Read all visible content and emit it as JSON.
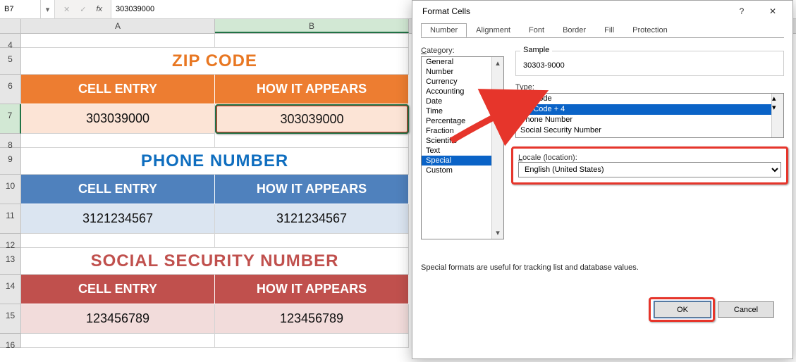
{
  "formula_bar": {
    "name_box": "B7",
    "cancel_icon": "✕",
    "accept_icon": "✓",
    "fx_label": "fx",
    "value": "303039000"
  },
  "columns": [
    "A",
    "B"
  ],
  "rows": [
    "4",
    "5",
    "6",
    "7",
    "8",
    "9",
    "10",
    "11",
    "12",
    "13",
    "14",
    "15",
    "16"
  ],
  "sections": {
    "zip": {
      "title": "ZIP CODE",
      "col1_header": "CELL ENTRY",
      "col2_header": "HOW IT APPEARS",
      "col1_value": "303039000",
      "col2_value": "303039000"
    },
    "phone": {
      "title": "PHONE NUMBER",
      "col1_header": "CELL ENTRY",
      "col2_header": "HOW IT APPEARS",
      "col1_value": "3121234567",
      "col2_value": "3121234567"
    },
    "ssn": {
      "title": "SOCIAL SECURITY NUMBER",
      "col1_header": "CELL ENTRY",
      "col2_header": "HOW IT APPEARS",
      "col1_value": "123456789",
      "col2_value": "123456789"
    }
  },
  "dialog": {
    "title": "Format Cells",
    "help_icon": "?",
    "close_icon": "✕",
    "tabs": [
      "Number",
      "Alignment",
      "Font",
      "Border",
      "Fill",
      "Protection"
    ],
    "active_tab": "Number",
    "category_label": "Category:",
    "categories": [
      "General",
      "Number",
      "Currency",
      "Accounting",
      "Date",
      "Time",
      "Percentage",
      "Fraction",
      "Scientific",
      "Text",
      "Special",
      "Custom"
    ],
    "selected_category": "Special",
    "sample_label": "Sample",
    "sample_value": "30303-9000",
    "type_label": "Type:",
    "types": [
      "Zip Code",
      "Zip Code + 4",
      "Phone Number",
      "Social Security Number"
    ],
    "selected_type": "Zip Code + 4",
    "locale_label": "Locale (location):",
    "locale_value": "English (United States)",
    "hint": "Special formats are useful for tracking list and database values.",
    "ok_label": "OK",
    "cancel_label": "Cancel"
  }
}
